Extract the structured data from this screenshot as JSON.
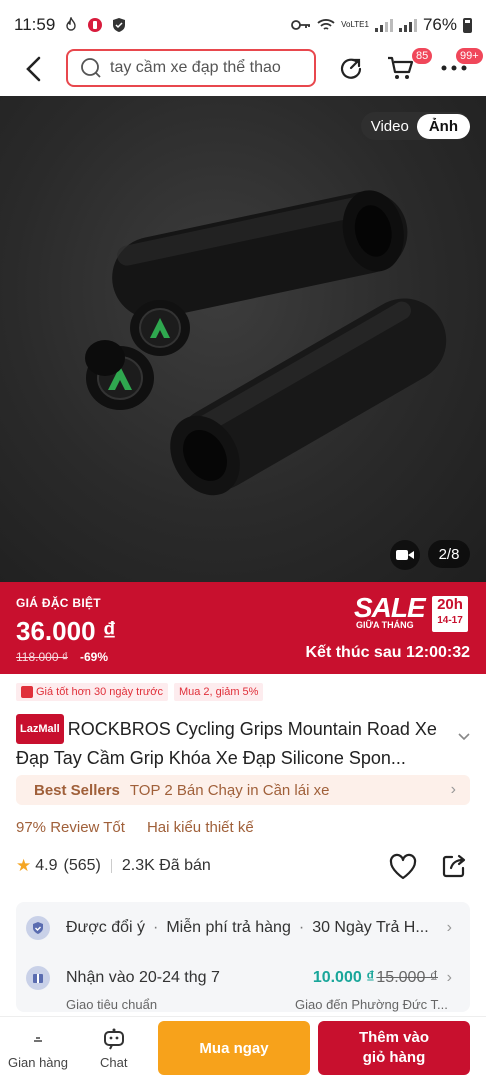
{
  "status_bar": {
    "time": "11:59",
    "battery": "76%",
    "network_label": "VoLTE1"
  },
  "header": {
    "search_value": "tay cầm xe đạp thể thao",
    "cart_badge": "85",
    "more_badge": "99+",
    "icons": [
      "back-arrow-icon",
      "search-icon",
      "share-refresh-icon",
      "cart-icon",
      "more-icon"
    ]
  },
  "gallery": {
    "toggle_video": "Video",
    "toggle_photo": "Ảnh",
    "counter": "2/8"
  },
  "price_banner": {
    "special_label": "GIÁ ĐẶC BIỆT",
    "price": "36.000 ₫",
    "old_price": "118.000 ₫",
    "discount": "-69%",
    "sale_word": "SALE",
    "sale_sub": "GIỮA THÁNG",
    "sale_hour": "20h",
    "sale_dates": "14-17",
    "countdown": "Kết thúc sau 12:00:32",
    "color": "#c8102e"
  },
  "tags": [
    "Giá tốt hơn 30 ngày trước",
    "Mua 2, giảm 5%"
  ],
  "product": {
    "store_badge": "LazMall",
    "title": "ROCKBROS Cycling Grips Mountain Road Xe Đạp Tay Cầm Grip Khóa Xe Đạp Silicone Spon...",
    "bestseller_label": "Best Sellers",
    "bestseller_text": "TOP 2 Bán Chạy in Cần lái xe",
    "review_good": "97% Review Tốt",
    "variants": "Hai kiểu thiết kế",
    "rating": "4.9",
    "rating_count": "(565)",
    "sold": "2.3K Đã bán"
  },
  "services": {
    "return_items": [
      "Được đổi ý",
      "Miễn phí trả hàng",
      "30 Ngày Trả H..."
    ],
    "delivery_date": "Nhận vào 20-24 thg 7",
    "delivery_type": "Giao tiêu chuẩn",
    "shipping_price": "10.000 ₫",
    "shipping_old": "15.000 ₫",
    "delivery_to": "Giao đến Phường Đức T..."
  },
  "bottom_bar": {
    "store": "Gian hàng",
    "chat": "Chat",
    "buy_now": "Mua ngay",
    "add_cart": "Thêm vào giỏ hàng",
    "buy_color": "#f7a21b"
  }
}
